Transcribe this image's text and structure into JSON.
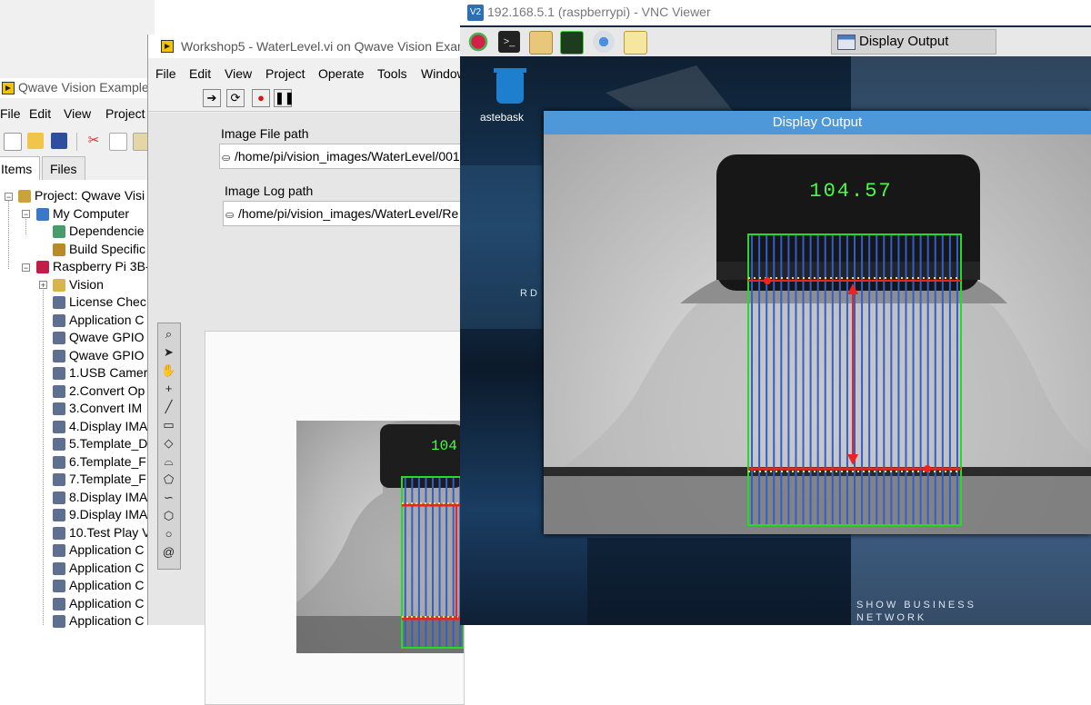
{
  "windowA": {
    "title": "Qwave Vision Example.",
    "menu": [
      "File",
      "Edit",
      "View",
      "Project"
    ],
    "tabs": [
      "Items",
      "Files"
    ],
    "tree": [
      {
        "label": "Project: Qwave Visi",
        "icon": "project-icon"
      },
      {
        "label": "My Computer",
        "icon": "computer-icon"
      },
      {
        "label": "Dependencie",
        "icon": "dependencies-icon"
      },
      {
        "label": "Build Specific",
        "icon": "build-spec-icon"
      },
      {
        "label": "Raspberry Pi 3B-",
        "icon": "raspberry-pi-icon"
      },
      {
        "label": "Vision",
        "icon": "folder-icon"
      },
      {
        "label": "License Chec",
        "icon": "vi-icon"
      },
      {
        "label": "Application C",
        "icon": "vi-icon"
      },
      {
        "label": "Qwave GPIO",
        "icon": "vi-icon"
      },
      {
        "label": "Qwave GPIO",
        "icon": "vi-icon"
      },
      {
        "label": "1.USB Camer",
        "icon": "vi-icon"
      },
      {
        "label": "2.Convert Op",
        "icon": "vi-icon"
      },
      {
        "label": "3.Convert IM",
        "icon": "vi-icon"
      },
      {
        "label": "4.Display IMA",
        "icon": "vi-icon"
      },
      {
        "label": "5.Template_D",
        "icon": "vi-icon"
      },
      {
        "label": "6.Template_F",
        "icon": "vi-icon"
      },
      {
        "label": "7.Template_F",
        "icon": "vi-icon"
      },
      {
        "label": "8.Display IMA",
        "icon": "vi-icon"
      },
      {
        "label": "9.Display IMA",
        "icon": "vi-icon"
      },
      {
        "label": "10.Test Play V",
        "icon": "vi-icon"
      },
      {
        "label": "Application C",
        "icon": "vi-icon"
      },
      {
        "label": "Application C",
        "icon": "vi-icon"
      },
      {
        "label": "Application C",
        "icon": "vi-icon"
      },
      {
        "label": "Application C",
        "icon": "vi-icon"
      },
      {
        "label": "Application C",
        "icon": "vi-icon"
      }
    ]
  },
  "windowB": {
    "title": "Workshop5 - WaterLevel.vi on Qwave Vision Examp",
    "menu": [
      "File",
      "Edit",
      "View",
      "Project",
      "Operate",
      "Tools",
      "Window"
    ],
    "image_file_label": "Image File path",
    "image_file_path": "/home/pi/vision_images/WaterLevel/001",
    "image_log_label": "Image Log path",
    "image_log_path": "/home/pi/vision_images/WaterLevel/Re",
    "small_reading": "104."
  },
  "windowC": {
    "title": "192.168.5.1 (raspberrypi) - VNC Viewer",
    "taskbar_button": "Display Output",
    "trash_label": "astebask",
    "bg_text_1": "SHOW BUSINESS",
    "bg_text_2": "NETWORK",
    "bg_text_3": "RD",
    "display_window_title": "Display Output",
    "reading": "104.57"
  },
  "colors": {
    "roi_green": "#22dd22",
    "scan_blue": "#2f5fd0",
    "edge_red": "#ee2222",
    "edge_yellow": "#f5e03a",
    "digits_green": "#44ff44",
    "vnc_header": "#4e97d8"
  }
}
